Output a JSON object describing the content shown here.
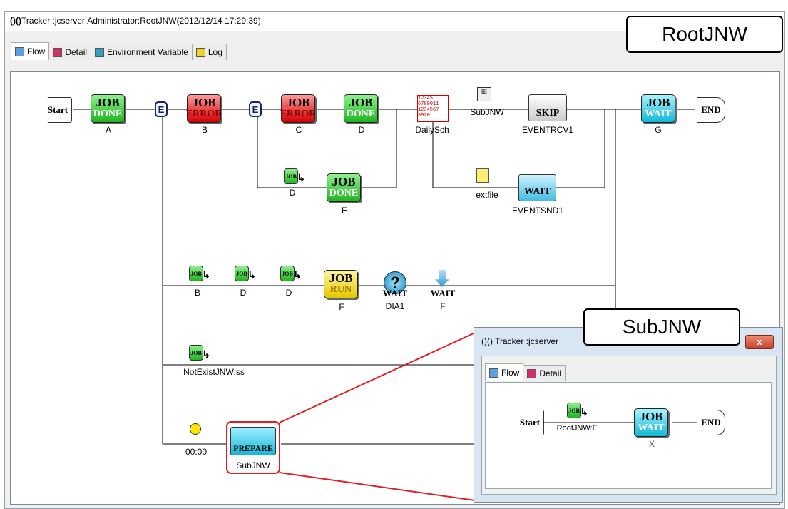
{
  "main_window": {
    "title": "Tracker :jcserver:Administrator:RootJNW(2012/12/14 17:29:39)",
    "tabs": [
      {
        "label": "Flow",
        "active": true
      },
      {
        "label": "Detail",
        "active": false
      },
      {
        "label": "Environment Variable",
        "active": false
      },
      {
        "label": "Log",
        "active": false
      }
    ]
  },
  "callouts": {
    "root": "RootJNW",
    "sub": "SubJNW"
  },
  "flow": {
    "start_label": "Start",
    "end_label": "END",
    "jobs": [
      {
        "id": "A",
        "status": "DONE",
        "label": "A"
      },
      {
        "id": "B",
        "status": "ERROR",
        "label": "B"
      },
      {
        "id": "C",
        "status": "ERROR",
        "label": "C"
      },
      {
        "id": "D",
        "status": "DONE",
        "label": "D"
      },
      {
        "id": "E",
        "status": "DONE",
        "label": "E"
      },
      {
        "id": "F",
        "status": "RUN",
        "label": "F"
      },
      {
        "id": "G",
        "status": "WAIT",
        "label": "G"
      }
    ],
    "job_word": "JOB",
    "other_labels": {
      "dailysch": "DailySch",
      "subjnw_top": "SubJNW",
      "eventrcv": "EVENTRCV1",
      "eventrcv_state": "SKIP",
      "extfile": "extfile",
      "eventsnd": "EVENTSND1",
      "eventsnd_state": "WAIT",
      "d_sub": "D",
      "row3_b": "B",
      "row3_d1": "D",
      "row3_d2": "D",
      "dia1": "DIA1",
      "dia_state": "WAIT",
      "f_wait_label": "F",
      "f_wait_state": "WAIT",
      "notexist": "NotExistJNW:ss",
      "time": "00:00",
      "subjnw_bottom": "SubJNW",
      "subjnw_state": "PREPARE"
    }
  },
  "sub_window": {
    "title": "Tracker :jcserver",
    "close_label": "x",
    "tabs": [
      {
        "label": "Flow",
        "active": true
      },
      {
        "label": "Detail",
        "active": false
      }
    ],
    "start_label": "Start",
    "end_label": "END",
    "ref_label": "RootJNW:F",
    "job_word": "JOB",
    "job_state": "WAIT",
    "job_label": "X"
  },
  "colors": {
    "highlight": "#e02020",
    "line": "#000000"
  }
}
